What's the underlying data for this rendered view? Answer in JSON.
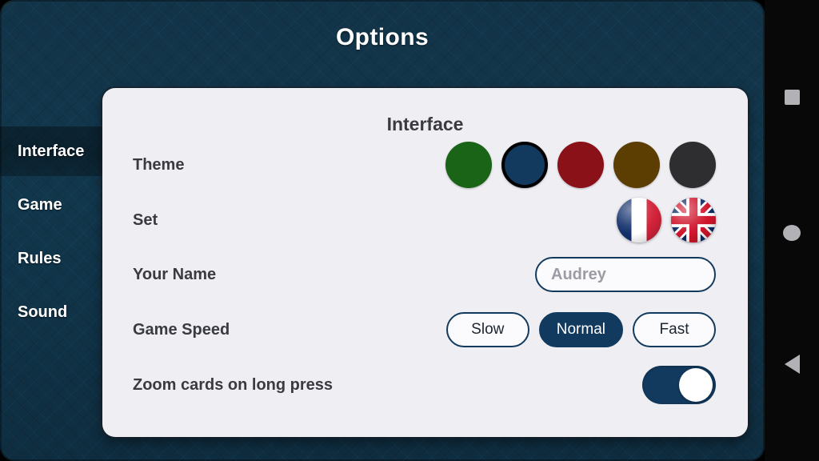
{
  "header": {
    "title": "Options"
  },
  "sidebar": {
    "items": [
      {
        "label": "Interface",
        "selected": true
      },
      {
        "label": "Game",
        "selected": false
      },
      {
        "label": "Rules",
        "selected": false
      },
      {
        "label": "Sound",
        "selected": false
      }
    ]
  },
  "panel": {
    "heading": "Interface",
    "rows": {
      "theme": {
        "label": "Theme",
        "swatches": [
          {
            "name": "green-theme",
            "color": "#1a6418",
            "selected": false
          },
          {
            "name": "blue-theme",
            "color": "#123a5e",
            "selected": true
          },
          {
            "name": "red-theme",
            "color": "#8b1118",
            "selected": false
          },
          {
            "name": "brown-theme",
            "color": "#5c3d02",
            "selected": false
          },
          {
            "name": "dark-theme",
            "color": "#2e2e30",
            "selected": false
          }
        ]
      },
      "set": {
        "label": "Set",
        "options": [
          {
            "name": "french-flag",
            "country": "France",
            "selected": false
          },
          {
            "name": "uk-flag",
            "country": "United Kingdom",
            "selected": false
          }
        ]
      },
      "your_name": {
        "label": "Your Name",
        "value": "",
        "placeholder": "Audrey"
      },
      "game_speed": {
        "label": "Game Speed",
        "options": [
          {
            "label": "Slow",
            "selected": false
          },
          {
            "label": "Normal",
            "selected": true
          },
          {
            "label": "Fast",
            "selected": false
          }
        ]
      },
      "zoom_cards": {
        "label": "Zoom cards on long press",
        "state": "on"
      }
    }
  },
  "navbar": {
    "buttons": [
      {
        "name": "recents-icon"
      },
      {
        "name": "home-icon"
      },
      {
        "name": "back-icon"
      }
    ]
  },
  "colors": {
    "accent": "#123a5e",
    "app_background": "#123449",
    "panel_background": "#eeeef3",
    "text_dark": "#3a3b40"
  }
}
